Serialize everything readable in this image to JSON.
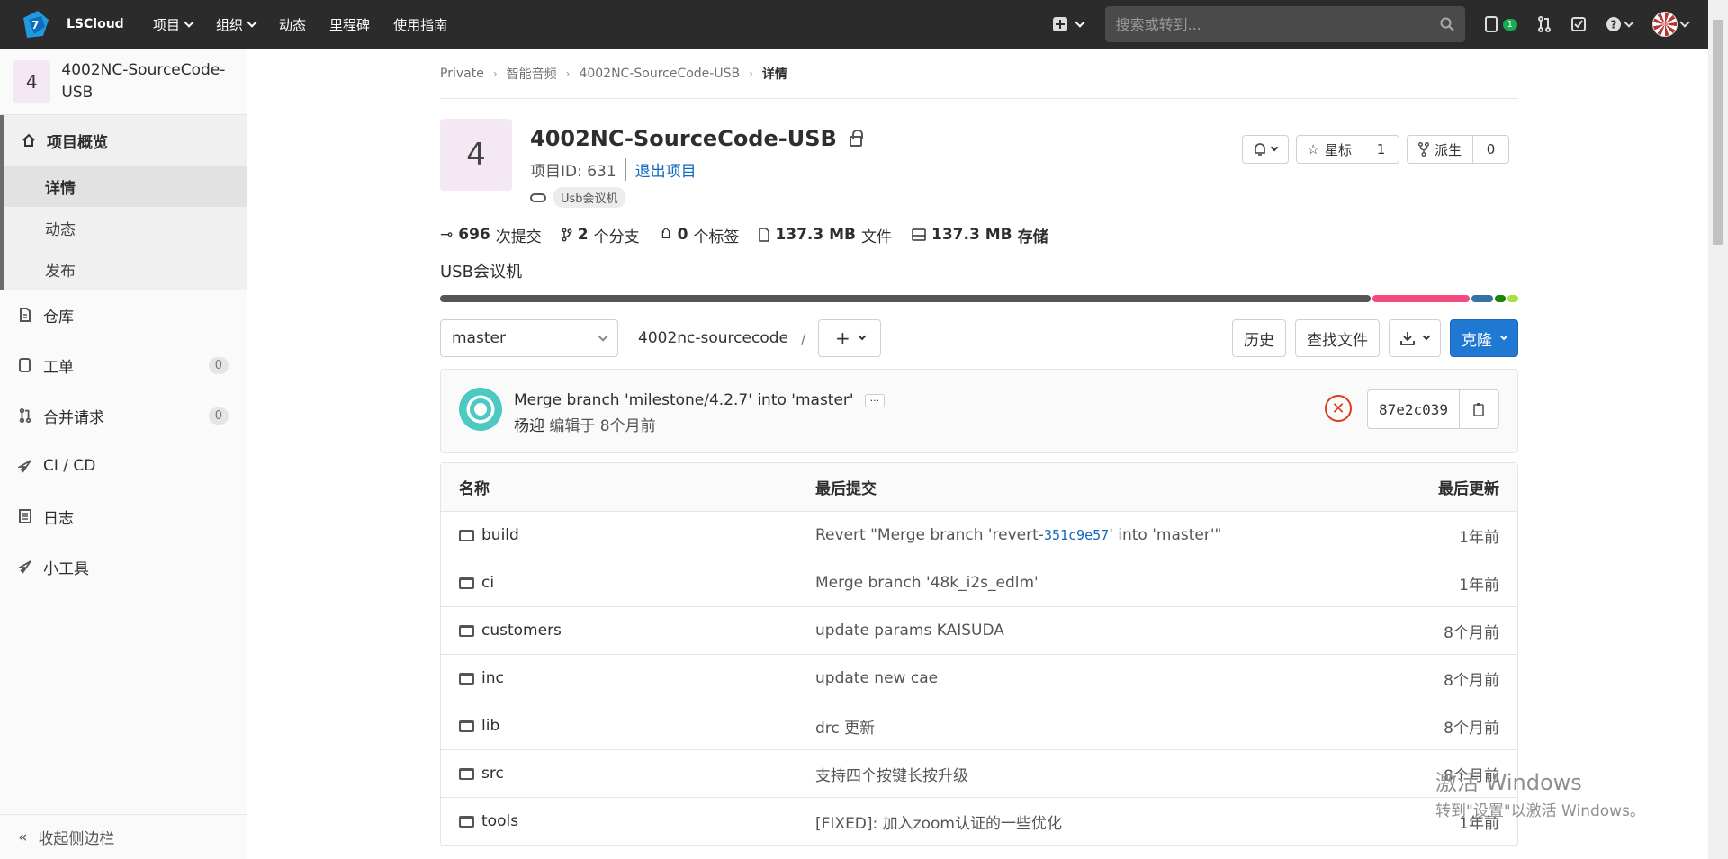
{
  "topbar": {
    "brand": "LSCloud",
    "nav": [
      "项目",
      "组织",
      "动态",
      "里程碑",
      "使用指南"
    ],
    "search_placeholder": "搜索或转到...",
    "notifications_count": "1"
  },
  "sidebar": {
    "project_avatar": "4",
    "project_name": "4002NC-SourceCode-USB",
    "overview": "项目概览",
    "overview_items": [
      "详情",
      "动态",
      "发布"
    ],
    "repository": "仓库",
    "issues": "工单",
    "issues_count": "0",
    "merge_requests": "合并请求",
    "merge_requests_count": "0",
    "ci_cd": "CI / CD",
    "logs": "日志",
    "tools": "小工具",
    "collapse": "收起侧边栏"
  },
  "breadcrumb": [
    "Private",
    "智能音频",
    "4002NC-SourceCode-USB",
    "详情"
  ],
  "project": {
    "avatar": "4",
    "name": "4002NC-SourceCode-USB",
    "id_text": "项目ID: 631",
    "leave": "退出项目",
    "topic": "Usb会议机",
    "star_label": "星标",
    "star_count": "1",
    "fork_label": "派生",
    "fork_count": "0",
    "description": "USB会议机"
  },
  "stats": [
    {
      "value": "696",
      "label": "次提交",
      "icon": "commit-icon"
    },
    {
      "value": "2",
      "label": "个分支",
      "icon": "branch-icon"
    },
    {
      "value": "0",
      "label": "个标签",
      "icon": "tag-icon"
    },
    {
      "value": "137.3 MB",
      "label": "文件",
      "icon": "file-icon"
    },
    {
      "value": "137.3 MB",
      "label": "存储",
      "icon": "storage-icon"
    }
  ],
  "languages": [
    {
      "color": "#555555",
      "share": 86
    },
    {
      "color": "#f34b7d",
      "share": 9
    },
    {
      "color": "#3572a5",
      "share": 2
    },
    {
      "color": "#178600",
      "share": 1
    },
    {
      "color": "#a8e047",
      "share": 1
    }
  ],
  "toolbar": {
    "branch": "master",
    "path": "4002nc-sourcecode",
    "path_sep": "/",
    "history": "历史",
    "find_file": "查找文件",
    "clone": "克隆"
  },
  "last_commit": {
    "title": "Merge branch 'milestone/4.2.7' into 'master'",
    "author": "杨迎",
    "meta": "编辑于 8个月前",
    "sha": "87e2c039"
  },
  "table": {
    "headers": [
      "名称",
      "最后提交",
      "最后更新"
    ],
    "rows": [
      {
        "name": "build",
        "msg_before": "Revert \"Merge branch 'revert-",
        "msg_link": "351c9e57",
        "msg_after": "' into 'master'\"",
        "time": "1年前"
      },
      {
        "name": "ci",
        "msg": "Merge branch '48k_i2s_edlm'",
        "time": "1年前"
      },
      {
        "name": "customers",
        "msg": "update params KAISUDA",
        "time": "8个月前"
      },
      {
        "name": "inc",
        "msg": "update new cae",
        "time": "8个月前"
      },
      {
        "name": "lib",
        "msg": "drc 更新",
        "time": "8个月前"
      },
      {
        "name": "src",
        "msg": "支持四个按键长按升级",
        "time": "8个月前"
      },
      {
        "name": "tools",
        "msg": "[FIXED]: 加入zoom认证的一些优化",
        "time": "1年前"
      }
    ]
  },
  "watermark": {
    "line1": "激活 Windows",
    "line2": "转到\"设置\"以激活 Windows。"
  }
}
